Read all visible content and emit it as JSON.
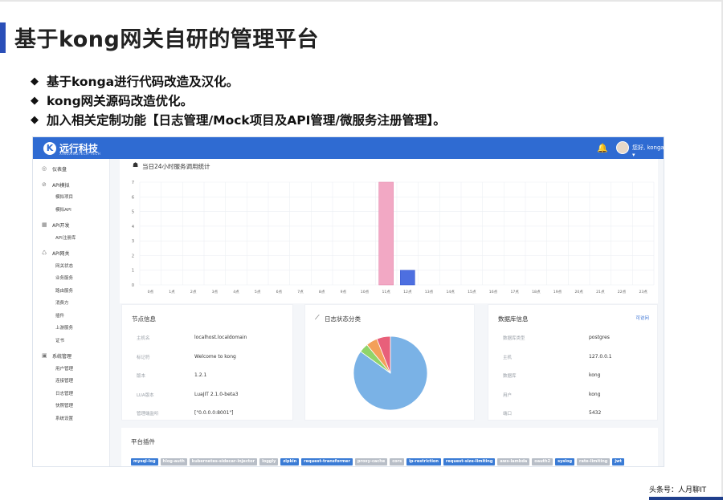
{
  "slide": {
    "title": "基于kong网关自研的管理平台",
    "bullets": [
      "基于konga进行代码改造及汉化。",
      "kong网关源码改造优化。",
      "加入相关定制功能【日志管理/Mock项目及API管理/微服务注册管理】。"
    ],
    "bullet_symbol": "◆",
    "watermark": "头条号：人月聊IT"
  },
  "app": {
    "logo": "远行科技",
    "logo_sub": "XINGXINGTECH TECH",
    "user": "您好, konga",
    "colors": {
      "topbar": "#2f6bd2",
      "bar_pink": "#f2a8c4",
      "bar_blue": "#4d6fe0"
    }
  },
  "sidebar": [
    {
      "label": "仪表盘",
      "icon": "dashboard-icon",
      "glyph": "◎",
      "subs": []
    },
    {
      "label": "API模拟",
      "icon": "shield-icon",
      "glyph": "⊘",
      "subs": [
        "模拟项目",
        "模拟API"
      ]
    },
    {
      "label": "API开发",
      "icon": "grid-icon",
      "glyph": "▦",
      "subs": [
        "API注册库"
      ]
    },
    {
      "label": "API网关",
      "icon": "gateway-icon",
      "glyph": "♺",
      "subs": [
        "网关状态",
        "业务服务",
        "路由服务",
        "消费方",
        "插件",
        "上游服务",
        "证书"
      ]
    },
    {
      "label": "系统管理",
      "icon": "settings-icon",
      "glyph": "▣",
      "subs": [
        "用户管理",
        "连接管理",
        "日志管理",
        "快照管理",
        "系统设置"
      ]
    }
  ],
  "chart_data": {
    "type": "bar",
    "title": "当日24小时服务调用统计",
    "categories": [
      "0点",
      "1点",
      "2点",
      "3点",
      "4点",
      "5点",
      "6点",
      "7点",
      "8点",
      "9点",
      "10点",
      "11点",
      "12点",
      "13点",
      "14点",
      "15点",
      "16点",
      "17点",
      "18点",
      "19点",
      "20点",
      "21点",
      "22点",
      "23点"
    ],
    "values": [
      0,
      0,
      0,
      0,
      0,
      0,
      0,
      0,
      0,
      0,
      0,
      7,
      1,
      0,
      0,
      0,
      0,
      0,
      0,
      0,
      0,
      0,
      0,
      0
    ],
    "ylim": [
      0,
      7
    ],
    "yticks": [
      "0",
      "1",
      "2",
      "3",
      "4",
      "5",
      "6",
      "7"
    ],
    "grid": true
  },
  "node_info": {
    "title": "节点信息",
    "rows": [
      {
        "key": "主机名",
        "value": "localhost.localdomain"
      },
      {
        "key": "标记符",
        "value": "Welcome to kong"
      },
      {
        "key": "版本",
        "value": "1.2.1"
      },
      {
        "key": "LUA版本",
        "value": "LuaJIT 2.1.0-beta3"
      },
      {
        "key": "管理端监听",
        "value": "[\"0.0.0.0:8001\"]"
      }
    ]
  },
  "log_status": {
    "title": "日志状态分类",
    "pie": [
      {
        "value": 85,
        "color": "#7ab2e6"
      },
      {
        "value": 4,
        "color": "#8fd46a"
      },
      {
        "value": 5,
        "color": "#f3a05a"
      },
      {
        "value": 6,
        "color": "#e8607a"
      }
    ]
  },
  "db_info": {
    "title": "数据库信息",
    "link": "可访问",
    "rows": [
      {
        "key": "数据库类型",
        "value": "postgres"
      },
      {
        "key": "主机",
        "value": "127.0.0.1"
      },
      {
        "key": "数据库",
        "value": "kong"
      },
      {
        "key": "用户",
        "value": "kong"
      },
      {
        "key": "端口",
        "value": "5432"
      }
    ]
  },
  "plugins": {
    "title": "平台插件",
    "tags": [
      {
        "label": "mysql-log",
        "active": true
      },
      {
        "label": "hlog-auth",
        "active": false
      },
      {
        "label": "kubernetes-sidecar-injector",
        "active": false
      },
      {
        "label": "loggly",
        "active": false
      },
      {
        "label": "zipkin",
        "active": true
      },
      {
        "label": "request-transformer",
        "active": true
      },
      {
        "label": "proxy-cache",
        "active": false
      },
      {
        "label": "cors",
        "active": false
      },
      {
        "label": "ip-restriction",
        "active": true
      },
      {
        "label": "request-size-limiting",
        "active": true
      },
      {
        "label": "aws-lambda",
        "active": false
      },
      {
        "label": "oauth2",
        "active": false
      },
      {
        "label": "syslog",
        "active": true
      },
      {
        "label": "rate-limiting",
        "active": false
      },
      {
        "label": "jwt",
        "active": true
      }
    ]
  }
}
